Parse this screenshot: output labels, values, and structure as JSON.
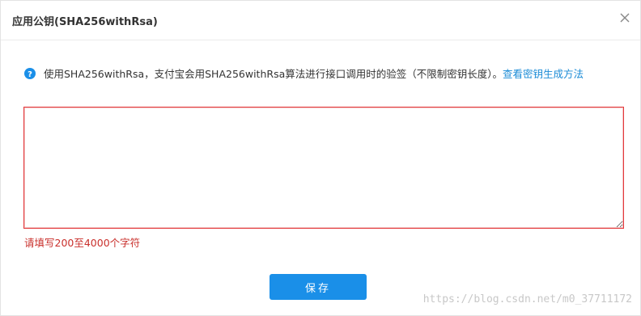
{
  "dialog": {
    "title": "应用公钥(SHA256withRsa)",
    "close_icon": "close-icon"
  },
  "tip": {
    "icon": "question-circle-icon",
    "text": "使用SHA256withRsa，支付宝会用SHA256withRsa算法进行接口调用时的验签（不限制密钥长度）。",
    "link_text": "查看密钥生成方法"
  },
  "form": {
    "key_value": "",
    "error_text": "请填写200至4000个字符"
  },
  "buttons": {
    "save_label": "保存"
  },
  "watermark": {
    "text": "https://blog.csdn.net/m0_37711172"
  },
  "colors": {
    "accent": "#1a8fe8",
    "link": "#1a8bd6",
    "error": "#c9302c",
    "error_border": "#e4393c"
  }
}
